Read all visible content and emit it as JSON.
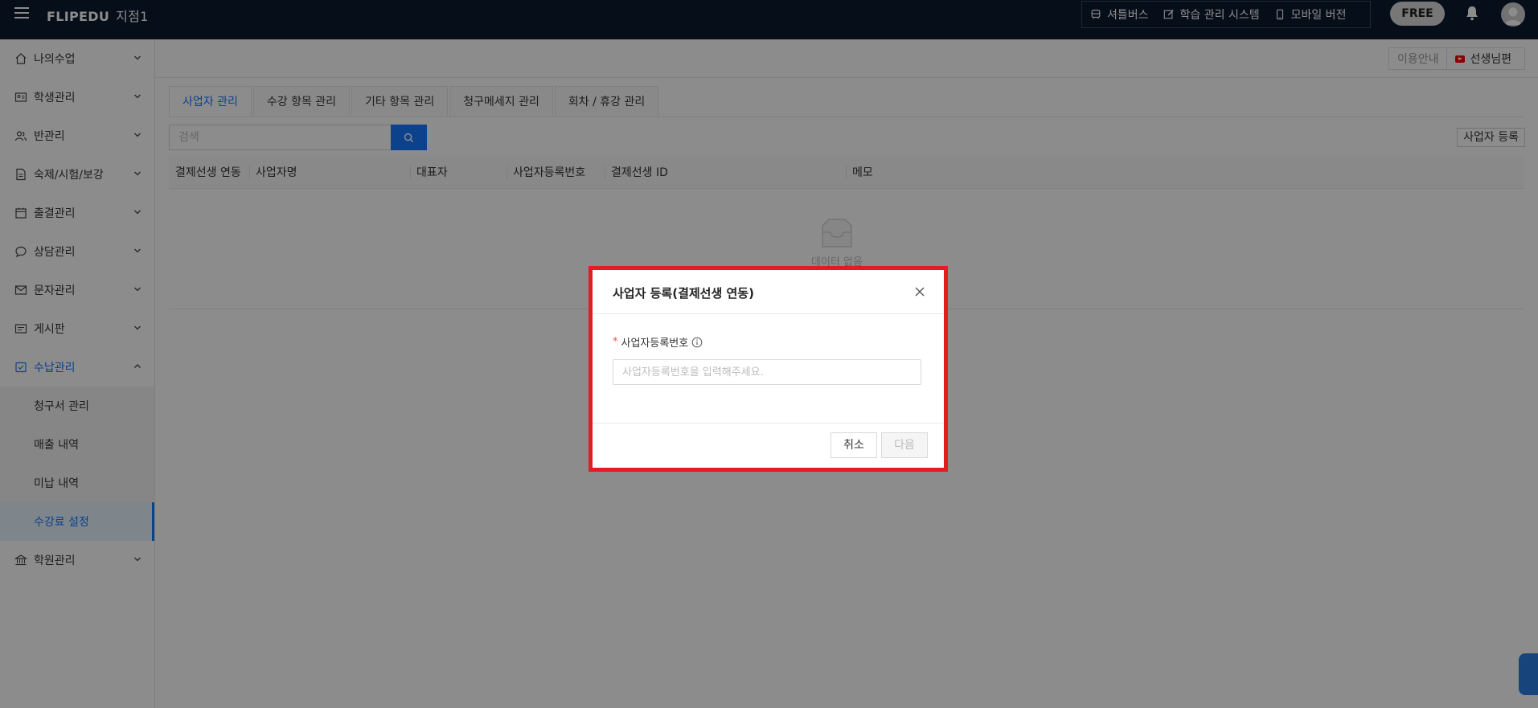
{
  "header": {
    "brand": "FLIPEDU",
    "branch": "지점1",
    "links": [
      {
        "label": "셔틀버스",
        "icon": "bus-icon"
      },
      {
        "label": "학습 관리 시스템",
        "icon": "edit-icon"
      },
      {
        "label": "모바일 버전",
        "icon": "mobile-icon"
      }
    ],
    "plan_badge": "FREE"
  },
  "sidebar": {
    "items": [
      {
        "label": "나의수업",
        "icon": "home-icon"
      },
      {
        "label": "학생관리",
        "icon": "id-card-icon"
      },
      {
        "label": "반관리",
        "icon": "users-icon"
      },
      {
        "label": "숙제/시험/보강",
        "icon": "document-icon"
      },
      {
        "label": "출결관리",
        "icon": "calendar-icon"
      },
      {
        "label": "상담관리",
        "icon": "chat-icon"
      },
      {
        "label": "문자관리",
        "icon": "mail-icon"
      },
      {
        "label": "게시판",
        "icon": "board-icon"
      },
      {
        "label": "수납관리",
        "icon": "wallet-icon"
      },
      {
        "label": "학원관리",
        "icon": "bank-icon"
      }
    ],
    "sub_items": [
      "청구서 관리",
      "매출 내역",
      "미납 내역",
      "수강료 설정"
    ],
    "active_sub": "수강료 설정"
  },
  "info_bar": {
    "guide": "이용안내",
    "teacher": "선생님편"
  },
  "tabs": [
    "사업자 관리",
    "수강 항목 관리",
    "기타 항목 관리",
    "청구메세지 관리",
    "회차 / 휴강 관리"
  ],
  "search": {
    "placeholder": "검색"
  },
  "register_button": "사업자 등록",
  "table": {
    "columns": [
      "결제선생 연동",
      "사업자명",
      "대표자",
      "사업자등록번호",
      "결제선생 ID",
      "메모"
    ],
    "empty_text": "데이터 없음"
  },
  "modal": {
    "title": "사업자 등록(결제선생 연동)",
    "field_label": "사업자등록번호",
    "field_placeholder": "사업자등록번호을 입력해주세요.",
    "cancel": "취소",
    "next": "다음"
  },
  "colors": {
    "topbar": "#0b1a30",
    "accent": "#1677ff",
    "highlight": "#e31b23"
  }
}
